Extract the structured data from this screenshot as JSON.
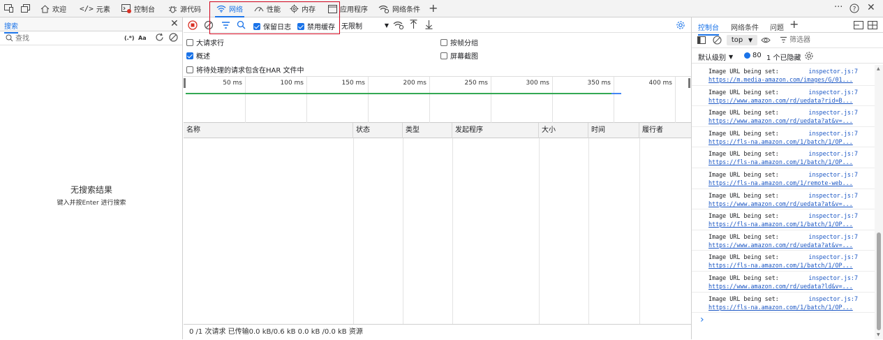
{
  "top_tabs": [
    {
      "label": "欢迎",
      "icon": "home-icon"
    },
    {
      "label": "元素",
      "icon": "code-icon"
    },
    {
      "label": "控制台",
      "icon": "console-icon"
    },
    {
      "label": "源代码",
      "icon": "bug-icon"
    },
    {
      "label": "网络",
      "icon": "wifi-icon",
      "active": true
    },
    {
      "label": "性能",
      "icon": "performance-icon"
    },
    {
      "label": "内存",
      "icon": "memory-icon"
    },
    {
      "label": "应用程序",
      "icon": "application-icon"
    },
    {
      "label": "网络条件",
      "icon": "network-conditions-icon"
    }
  ],
  "left": {
    "tab_label": "搜索",
    "search_placeholder": "查找",
    "regex_label": "(.*)",
    "case_label": "Aa",
    "empty_title": "无搜索结果",
    "empty_hint": "键入并按Enter 进行搜索"
  },
  "network": {
    "preserve_log": "保留日志",
    "disable_cache": "禁用缓存",
    "throttle": "无限制",
    "options": {
      "large_rows": "大请求行",
      "group_by_frame": "按帧分组",
      "overview": "概述",
      "screenshots": "屏幕截图",
      "har_pending": "将待处理的请求包含在HAR 文件中"
    },
    "timeline_ticks": [
      "50 ms",
      "100 ms",
      "150 ms",
      "200 ms",
      "250 ms",
      "300 ms",
      "350 ms",
      "400 ms"
    ],
    "columns": [
      "名称",
      "状态",
      "类型",
      "发起程序",
      "大小",
      "时间",
      "履行者"
    ],
    "status": "0 /1 次请求  已传输0.0 kB/0.6 kB   0.0 kB /0.0 kB 资源"
  },
  "console": {
    "tabs": [
      "控制台",
      "网络条件",
      "问题"
    ],
    "context": "top",
    "filter_placeholder": "筛选器",
    "level": "默认级别",
    "issues_count": "80",
    "hidden": "1 个已隐藏",
    "prompt": "›",
    "messages": [
      {
        "text": "Image URL being set:",
        "source": "inspector.js:7",
        "url": "https://m.media-amazon.com/images/G/01..."
      },
      {
        "text": "Image URL being set:",
        "source": "inspector.js:7",
        "url": "https://www.amazon.com/rd/uedata?rid=B..."
      },
      {
        "text": "Image URL being set:",
        "source": "inspector.js:7",
        "url": "https://www.amazon.com/rd/uedata?at&v=..."
      },
      {
        "text": "Image URL being set:",
        "source": "inspector.js:7",
        "url": "https://fls-na.amazon.com/1/batch/1/OP..."
      },
      {
        "text": "Image URL being set:",
        "source": "inspector.js:7",
        "url": "https://fls-na.amazon.com/1/batch/1/OP..."
      },
      {
        "text": "Image URL being set:",
        "source": "inspector.js:7",
        "url": "https://fls-na.amazon.com/1/remote-web..."
      },
      {
        "text": "Image URL being set:",
        "source": "inspector.js:7",
        "url": "https://www.amazon.com/rd/uedata?at&v=..."
      },
      {
        "text": "Image URL being set:",
        "source": "inspector.js:7",
        "url": "https://fls-na.amazon.com/1/batch/1/OP..."
      },
      {
        "text": "Image URL being set:",
        "source": "inspector.js:7",
        "url": "https://www.amazon.com/rd/uedata?at&v=..."
      },
      {
        "text": "Image URL being set:",
        "source": "inspector.js:7",
        "url": "https://fls-na.amazon.com/1/batch/1/OP..."
      },
      {
        "text": "Image URL being set:",
        "source": "inspector.js:7",
        "url": "https://www.amazon.com/rd/uedata?ld&v=..."
      },
      {
        "text": "Image URL being set:",
        "source": "inspector.js:7",
        "url": "https://fls-na.amazon.com/1/batch/1/OP..."
      }
    ]
  },
  "colors": {
    "accent": "#1a73e8",
    "highlight_box": "#d0021b",
    "timeline_green": "#34a853",
    "timeline_blue": "#4285f4"
  }
}
